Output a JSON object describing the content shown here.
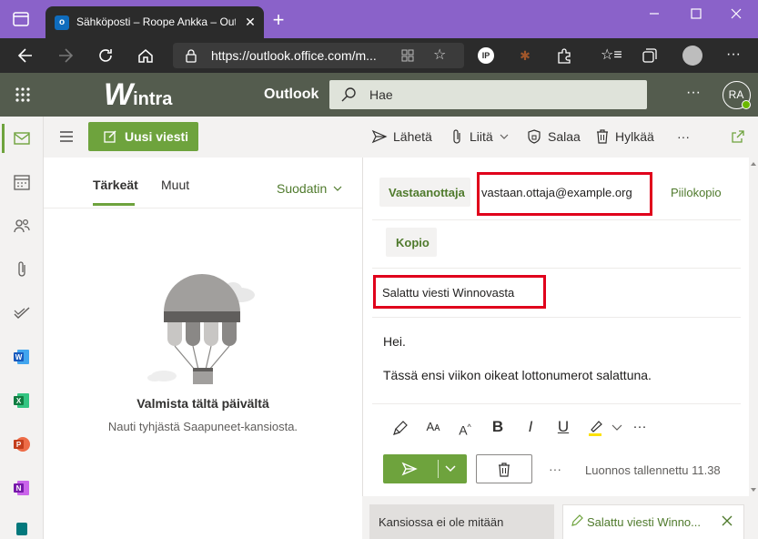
{
  "browser": {
    "tab_title": "Sähköposti – Roope Ankka – Outlook",
    "favicon_letter": "o",
    "url": "https://outlook.office.com/m..."
  },
  "header": {
    "brand_letter": "W",
    "brand_rest": "intra",
    "app_name": "Outlook",
    "search_placeholder": "Hae",
    "more": "···",
    "avatar_initials": "RA"
  },
  "commands": {
    "new_message": "Uusi viesti",
    "send": "Lähetä",
    "attach": "Liitä",
    "encrypt": "Salaa",
    "discard": "Hylkää",
    "more": "···"
  },
  "list": {
    "tabs": [
      "Tärkeät",
      "Muut"
    ],
    "filter": "Suodatin",
    "empty_title": "Valmista tältä päivältä",
    "empty_subtitle": "Nauti tyhjästä Saapuneet-kansiosta."
  },
  "compose": {
    "to_label": "Vastaanottaja",
    "to_value": "vastaan.ottaja@example.org",
    "bcc_label": "Piilokopio",
    "cc_label": "Kopio",
    "subject": "Salattu viesti Winnovasta",
    "body_line1": "Hei.",
    "body_line2": "Tässä ensi viikon oikeat lottonumerot salattuna.",
    "more_dots": "···",
    "draft_status": "Luonnos tallennettu 11.38"
  },
  "bottom": {
    "folder_empty": "Kansiossa ei ole mitään",
    "draft_tab": "Salattu viesti Winno..."
  },
  "colors": {
    "accent_green": "#6ea33d",
    "header_bg": "#545c4e",
    "browser_purple": "#8a62c9",
    "highlight_red": "#e0001b"
  }
}
